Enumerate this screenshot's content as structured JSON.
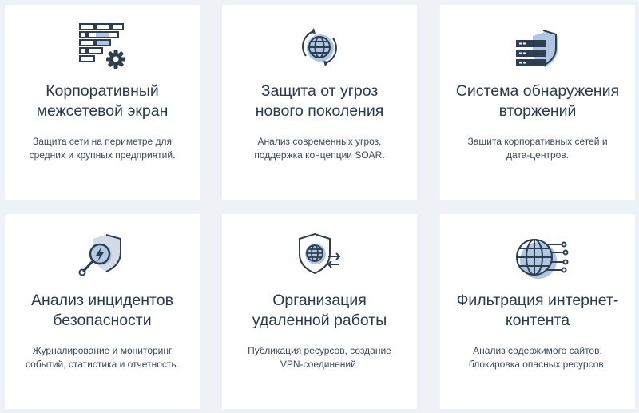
{
  "cards": [
    {
      "title": "Корпоративный\nмежсетевой экран",
      "desc": "Защита сети на периметре для\nсредних и крупных предприятий.",
      "icon": "firewall-gear-icon"
    },
    {
      "title": "Защита от угроз\nнового поколения",
      "desc": "Анализ современных угроз,\nподдержка концепции SOAR.",
      "icon": "globe-rotate-icon"
    },
    {
      "title": "Система обнаружения\nвторжений",
      "desc": "Защита корпоративных сетей и\nдата-центров.",
      "icon": "server-shield-icon"
    },
    {
      "title": "Анализ инцидентов\nбезопасности",
      "desc": "Журналирование и мониторинг\nсобытий, статистика и отчетность.",
      "icon": "magnifier-shield-icon"
    },
    {
      "title": "Организация\nудаленной работы",
      "desc": "Публикация ресурсов, создание\nVPN-соединений.",
      "icon": "vpn-shield-icon"
    },
    {
      "title": "Фильтрация интернет-\nконтента",
      "desc": "Анализ содержимого сайтов,\nблокировка опасных ресурсов.",
      "icon": "globe-filter-icon"
    }
  ]
}
